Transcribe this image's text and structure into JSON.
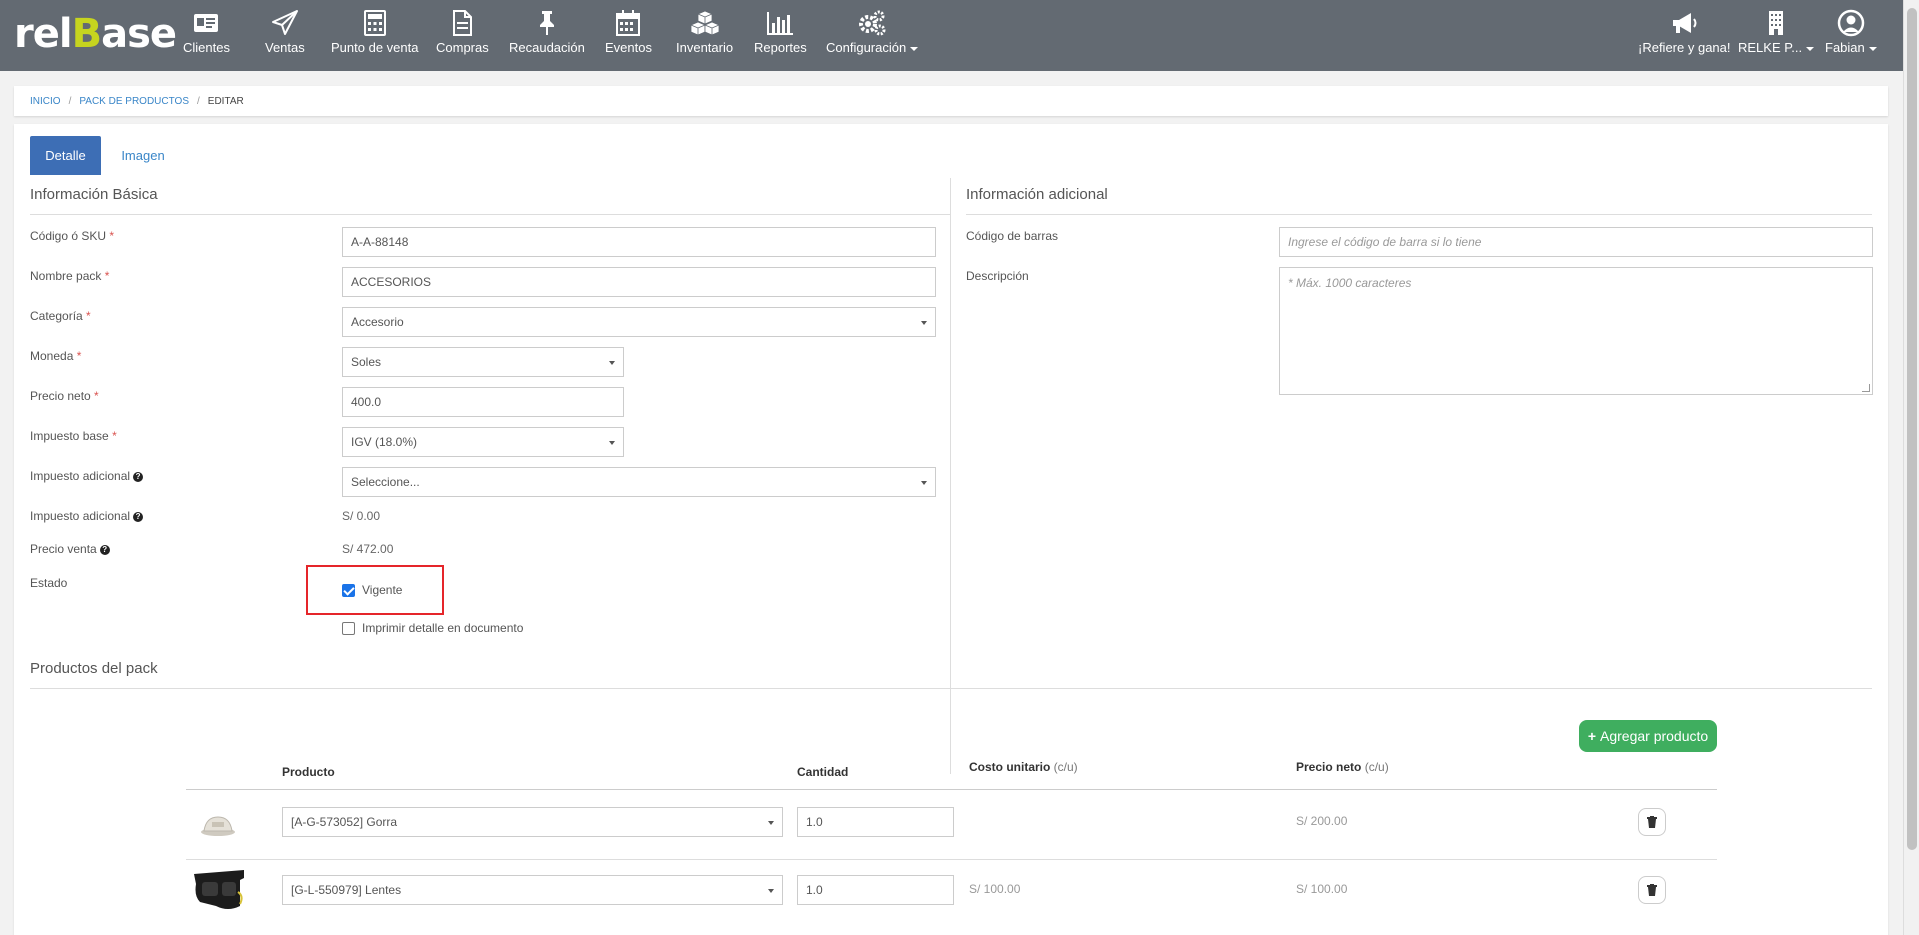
{
  "brand": {
    "logo_pre": "rel",
    "logo_b": "B",
    "logo_post": "ase",
    "accent": "#c6d41f"
  },
  "nav": {
    "items": [
      {
        "label": "Clientes",
        "icon": "id-card-icon"
      },
      {
        "label": "Ventas",
        "icon": "paper-plane-icon"
      },
      {
        "label": "Punto de venta",
        "icon": "calculator-icon"
      },
      {
        "label": "Compras",
        "icon": "document-icon"
      },
      {
        "label": "Recaudación",
        "icon": "pin-icon"
      },
      {
        "label": "Eventos",
        "icon": "calendar-icon"
      },
      {
        "label": "Inventario",
        "icon": "boxes-icon"
      },
      {
        "label": "Reportes",
        "icon": "bar-chart-icon"
      },
      {
        "label": "Configuración",
        "icon": "gears-icon"
      }
    ],
    "right": [
      {
        "label": "¡Refiere y gana!",
        "icon": "megaphone-icon"
      },
      {
        "label": "RELKE P...",
        "icon": "building-icon"
      },
      {
        "label": "Fabian",
        "icon": "user-icon"
      }
    ]
  },
  "breadcrumb": {
    "home": "INICIO",
    "section": "PACK DE PRODUCTOS",
    "current": "EDITAR"
  },
  "tabs": {
    "detail": "Detalle",
    "image": "Imagen"
  },
  "basic": {
    "title": "Información Básica",
    "sku_label": "Código ó SKU",
    "sku_value": "A-A-88148",
    "name_label": "Nombre pack",
    "name_value": "ACCESORIOS",
    "category_label": "Categoría",
    "category_value": "Accesorio",
    "currency_label": "Moneda",
    "currency_value": "Soles",
    "net_price_label": "Precio neto",
    "net_price_value": "400.0",
    "base_tax_label": "Impuesto base",
    "base_tax_value": "IGV (18.0%)",
    "extra_tax_label": "Impuesto adicional",
    "extra_tax_value": "Seleccione...",
    "extra_tax_amount_label": "Impuesto adicional",
    "extra_tax_amount": "S/ 0.00",
    "sale_price_label": "Precio venta",
    "sale_price": "S/ 472.00",
    "status_label": "Estado",
    "status_checkbox": "Vigente",
    "status_checked": true,
    "print_checkbox": "Imprimir detalle en documento",
    "print_checked": false,
    "required_mark": "*"
  },
  "additional": {
    "title": "Información adicional",
    "barcode_label": "Código de barras",
    "barcode_placeholder": "Ingrese el código de barra si lo tiene",
    "description_label": "Descripción",
    "description_placeholder": "* Máx. 1000 caracteres"
  },
  "products": {
    "title": "Productos del pack",
    "add_button": "Agregar producto",
    "headers": {
      "product": "Producto",
      "quantity": "Cantidad",
      "unit_cost": "Costo unitario",
      "unit_cost_sub": "(c/u)",
      "net_price": "Precio neto",
      "net_price_sub": "(c/u)"
    },
    "rows": [
      {
        "product": "[A-G-573052] Gorra",
        "quantity": "1.0",
        "unit_cost": "",
        "net_price": "S/ 200.00"
      },
      {
        "product": "[G-L-550979] Lentes",
        "quantity": "1.0",
        "unit_cost": "S/ 100.00",
        "net_price": "S/ 100.00"
      }
    ]
  }
}
